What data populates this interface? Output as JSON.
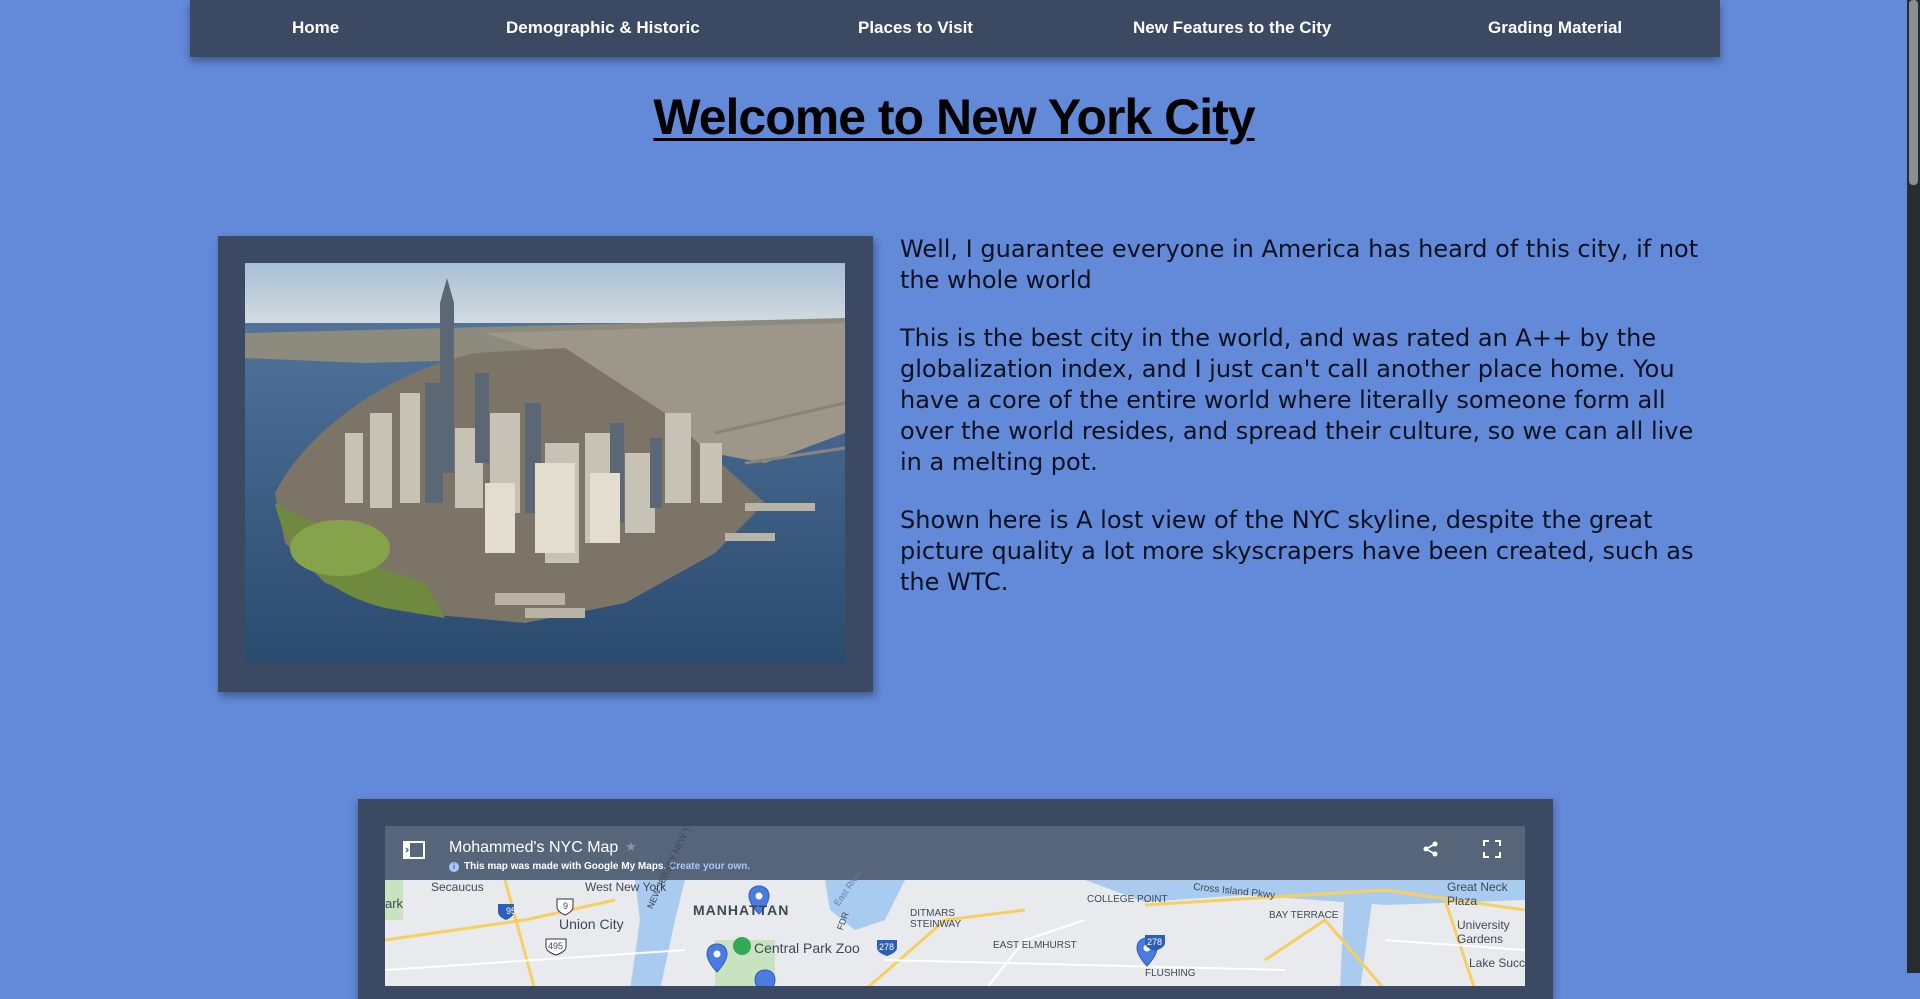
{
  "nav": {
    "items": [
      {
        "label": "Home"
      },
      {
        "label": "Demographic & Historic"
      },
      {
        "label": "Places to Visit"
      },
      {
        "label": "New Features to the City"
      },
      {
        "label": "Grading Material"
      }
    ]
  },
  "heading": {
    "title": "Welcome to New York City"
  },
  "intro": {
    "paragraphs": [
      "Well, I guarantee everyone in America has heard of this city, if not the whole world",
      "This is the best city in the world, and was rated an A++ by the globalization index, and I just can't call another place home. You have a core of the entire world where literally someone form all over the world resides, and spread their culture, so we can all live in a melting pot.",
      "Shown here is A lost view of the NYC skyline, despite the great picture quality a lot more skyscrapers have been created, such as the WTC."
    ]
  },
  "map": {
    "title": "Mohammed's NYC Map",
    "info_text": "This map was made with Google My Maps.",
    "create_link": "Create your own.",
    "labels": {
      "manhattan": "MANHATTAN",
      "secaucus": "Secaucus",
      "west_new_york": "West New York",
      "union_city": "Union City",
      "central_park_zoo": "Central Park Zoo",
      "ditmars": "DITMARS STEINWAY",
      "east_elmhurst": "EAST ELMHURST",
      "college_point": "COLLEGE POINT",
      "bay_terrace": "BAY TERRACE",
      "great_neck_plaza": "Great Neck Plaza",
      "university_gardens": "University Gardens",
      "lake_success": "Lake Succ",
      "flushing": "FLUSHING",
      "cross_island_pkwy": "Cross Island Pkwy",
      "new_jersey": "NEW JERSEY NEW YORK",
      "east_river": "East River",
      "fdr": "FDR",
      "ark": "ark"
    },
    "shields": {
      "i95": "95",
      "i495": "495",
      "r9": "9",
      "i278a": "278",
      "i278b": "278"
    }
  },
  "colors": {
    "page_background": "#6389d9",
    "nav_background": "#3b4a62",
    "frame_background": "#3b4a62",
    "map_header": "#56657a",
    "text": "#0d1220"
  }
}
